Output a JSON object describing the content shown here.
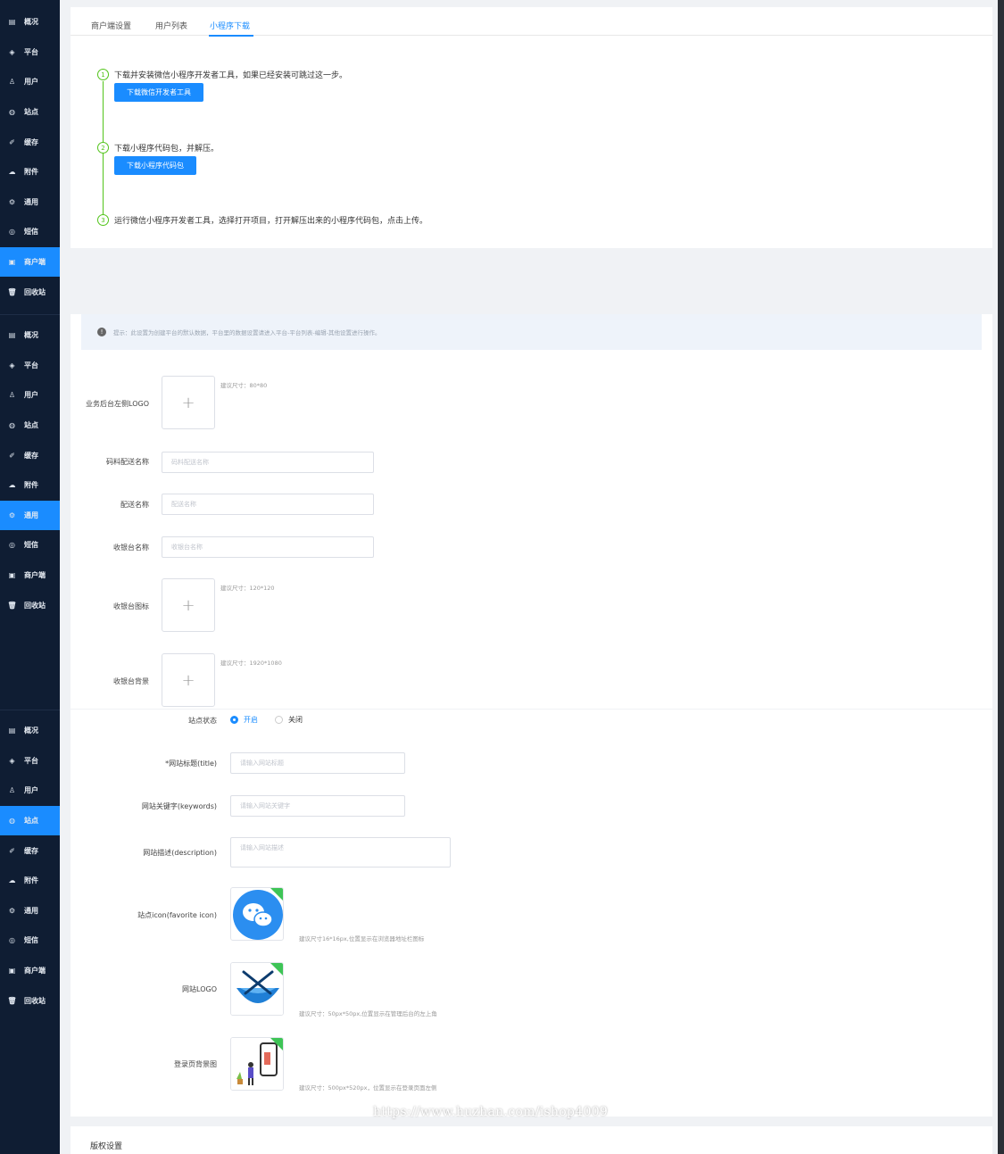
{
  "sidebar": {
    "groups": [
      {
        "items": [
          {
            "label": "概况",
            "icon": "dashboard-icon"
          },
          {
            "label": "平台",
            "icon": "platform-icon"
          },
          {
            "label": "用户",
            "icon": "user-icon"
          },
          {
            "label": "站点",
            "icon": "globe-icon"
          },
          {
            "label": "缓存",
            "icon": "cache-icon"
          },
          {
            "label": "附件",
            "icon": "cloud-upload-icon"
          },
          {
            "label": "通用",
            "icon": "settings-icon"
          },
          {
            "label": "短信",
            "icon": "sms-icon"
          },
          {
            "label": "商户端",
            "icon": "merchant-icon"
          },
          {
            "label": "回收站",
            "icon": "trash-icon"
          }
        ],
        "active": 8
      },
      {
        "items": [
          {
            "label": "概况",
            "icon": "dashboard-icon"
          },
          {
            "label": "平台",
            "icon": "platform-icon"
          },
          {
            "label": "用户",
            "icon": "user-icon"
          },
          {
            "label": "站点",
            "icon": "globe-icon"
          },
          {
            "label": "缓存",
            "icon": "cache-icon"
          },
          {
            "label": "附件",
            "icon": "cloud-upload-icon"
          },
          {
            "label": "通用",
            "icon": "settings-icon"
          },
          {
            "label": "短信",
            "icon": "sms-icon"
          },
          {
            "label": "商户端",
            "icon": "merchant-icon"
          },
          {
            "label": "回收站",
            "icon": "trash-icon"
          }
        ],
        "active": 6
      },
      {
        "items": [
          {
            "label": "概况",
            "icon": "dashboard-icon"
          },
          {
            "label": "平台",
            "icon": "platform-icon"
          },
          {
            "label": "用户",
            "icon": "user-icon"
          },
          {
            "label": "站点",
            "icon": "globe-icon"
          },
          {
            "label": "缓存",
            "icon": "cache-icon"
          },
          {
            "label": "附件",
            "icon": "cloud-upload-icon"
          },
          {
            "label": "通用",
            "icon": "settings-icon"
          },
          {
            "label": "短信",
            "icon": "sms-icon"
          },
          {
            "label": "商户端",
            "icon": "merchant-icon"
          },
          {
            "label": "回收站",
            "icon": "trash-icon"
          }
        ],
        "active": 3
      }
    ]
  },
  "panel1": {
    "tabs": [
      "商户端设置",
      "用户列表",
      "小程序下载"
    ],
    "active_tab": 2,
    "steps": [
      {
        "num": "1",
        "text": "下载并安装微信小程序开发者工具，如果已经安装可跳过这一步。",
        "button": "下载微信开发者工具"
      },
      {
        "num": "2",
        "text": "下载小程序代码包，并解压。",
        "button": "下载小程序代码包"
      },
      {
        "num": "3",
        "text": "运行微信小程序开发者工具，选择打开项目，打开解压出来的小程序代码包，点击上传。"
      }
    ]
  },
  "panel2": {
    "tip": "提示：此设置为创建平台的默认数据，平台里的数据设置请进入平台-平台列表-编辑-其他设置进行操作。",
    "fields": {
      "logo_label": "业务后台左侧LOGO",
      "logo_hint": "建议尺寸：80*80",
      "code_delivery_label": "码料配送名称",
      "code_delivery_placeholder": "码料配送名称",
      "delivery_label": "配送名称",
      "delivery_placeholder": "配送名称",
      "cashier_label": "收银台名称",
      "cashier_placeholder": "收银台名称",
      "cashier_icon_label": "收银台图标",
      "cashier_icon_hint": "建议尺寸：120*120",
      "cashier_bg_label": "收银台背景",
      "cashier_bg_hint": "建议尺寸：1920*1080"
    }
  },
  "panel3": {
    "status_label": "站点状态",
    "status_on": "开启",
    "status_off": "关闭",
    "title_label": "*网站标题(title)",
    "title_placeholder": "请输入网站标题",
    "keywords_label": "网站关键字(keywords)",
    "keywords_placeholder": "请输入网站关键字",
    "desc_label": "网站描述(description)",
    "desc_placeholder": "请输入网站描述",
    "favicon_label": "站点icon(favorite icon)",
    "favicon_hint": "建议尺寸16*16px,位置显示在浏览器地址栏图标",
    "logo_label": "网站LOGO",
    "logo_hint": "建议尺寸：50px*50px,位置显示在管理后台的左上角",
    "login_bg_label": "登录页背景图",
    "login_bg_hint": "建议尺寸：500px*520px，位置显示在登录页面左侧"
  },
  "watermark": "https://www.huzhan.com/ishop4009",
  "panel4": {
    "title": "版权设置"
  },
  "colors": {
    "sidebar": "#0f1d33",
    "accent": "#1a8cff",
    "success": "#52c41a"
  }
}
